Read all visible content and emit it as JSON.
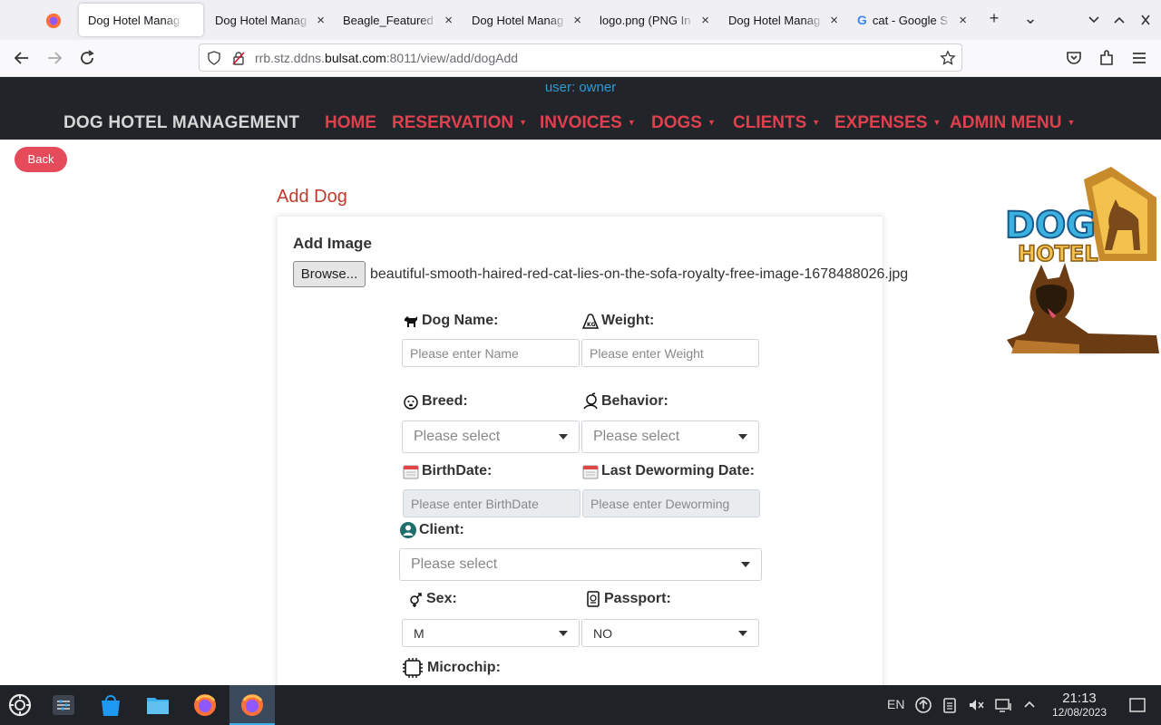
{
  "browser": {
    "tabs": [
      {
        "title": "Dog Hotel Manag",
        "active": true
      },
      {
        "title": "Dog Hotel Manag",
        "active": false
      },
      {
        "title": "Beagle_Featured",
        "active": false
      },
      {
        "title": "Dog Hotel Manag",
        "active": false
      },
      {
        "title": "logo.png (PNG In",
        "active": false
      },
      {
        "title": "Dog Hotel Manag",
        "active": false
      },
      {
        "title": "cat - Google S",
        "active": false
      }
    ],
    "close_glyph": "×",
    "new_tab_glyph": "+",
    "list_tabs_glyph": "⌄",
    "url_host_prefix": "rrb.stz.ddns.",
    "url_host_main": "bulsat.com",
    "url_rest": ":8011/view/add/dogAdd",
    "google_letter": "G"
  },
  "header": {
    "user_line": "user: owner",
    "brand": "DOG HOTEL MANAGEMENT",
    "menu": [
      "HOME",
      "RESERVATION",
      "INVOICES",
      "DOGS",
      "CLIENTS",
      "EXPENSES",
      "ADMIN MENU"
    ]
  },
  "page": {
    "back_label": "Back",
    "title": "Add Dog",
    "add_image_label": "Add Image",
    "browse_label": "Browse...",
    "file_name": "beautiful-smooth-haired-red-cat-lies-on-the-sofa-royalty-free-image-1678488026.jpg"
  },
  "form": {
    "dog_name_label": "Dog Name:",
    "dog_name_placeholder": "Please enter Name",
    "weight_label": "Weight:",
    "weight_placeholder": "Please enter Weight",
    "breed_label": "Breed:",
    "breed_value": "Please select",
    "behavior_label": "Behavior:",
    "behavior_value": "Please select",
    "birthdate_label": "BirthDate:",
    "birthdate_placeholder": "Please enter BirthDate",
    "deworming_label": "Last Deworming Date:",
    "deworming_placeholder": "Please enter Deworming",
    "client_label": "Client:",
    "client_value": "Please select",
    "sex_label": "Sex:",
    "sex_value": "M",
    "passport_label": "Passport:",
    "passport_value": "NO",
    "microchip_label": "Microchip:"
  },
  "logo": {
    "text_dog": "DOG",
    "text_hotel": "HOTEL"
  },
  "taskbar": {
    "lang": "EN",
    "time": "21:13",
    "date": "12/08/2023"
  }
}
